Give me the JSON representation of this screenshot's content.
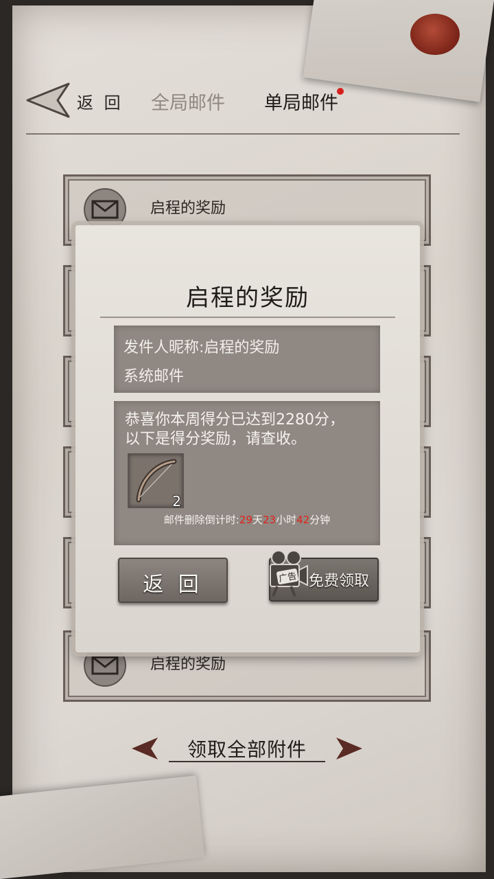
{
  "header": {
    "back_label": "返 回",
    "tabs": [
      {
        "label": "全局邮件",
        "active": false
      },
      {
        "label": "单局邮件",
        "active": true,
        "has_notification": true
      }
    ]
  },
  "mail_list": [
    {
      "title": "启程的奖励"
    },
    {
      "title": ""
    },
    {
      "title": ""
    },
    {
      "title": ""
    },
    {
      "title": ""
    },
    {
      "title": "启程的奖励"
    }
  ],
  "dialog": {
    "title": "启程的奖励",
    "sender_line": "发件人昵称:启程的奖励",
    "type_line": "系统邮件",
    "body_line1": "恭喜你本周得分已达到2280分，",
    "body_line2": "以下是得分奖励，请查收。",
    "attachment": {
      "icon": "bow-icon",
      "count": "2"
    },
    "countdown": {
      "prefix": "邮件删除倒计时:",
      "days": "29",
      "days_unit": "天",
      "hours": "23",
      "hours_unit": "小时",
      "minutes": "42",
      "minutes_unit": "分钟"
    },
    "back_button": "返 回",
    "ad_tag": "广告",
    "free_claim_button": "免费领取"
  },
  "footer": {
    "collect_all": "领取全部附件"
  },
  "colors": {
    "notification": "#d6201b",
    "countdown_highlight": "#e0231b",
    "wax_seal": "#9a3222"
  }
}
